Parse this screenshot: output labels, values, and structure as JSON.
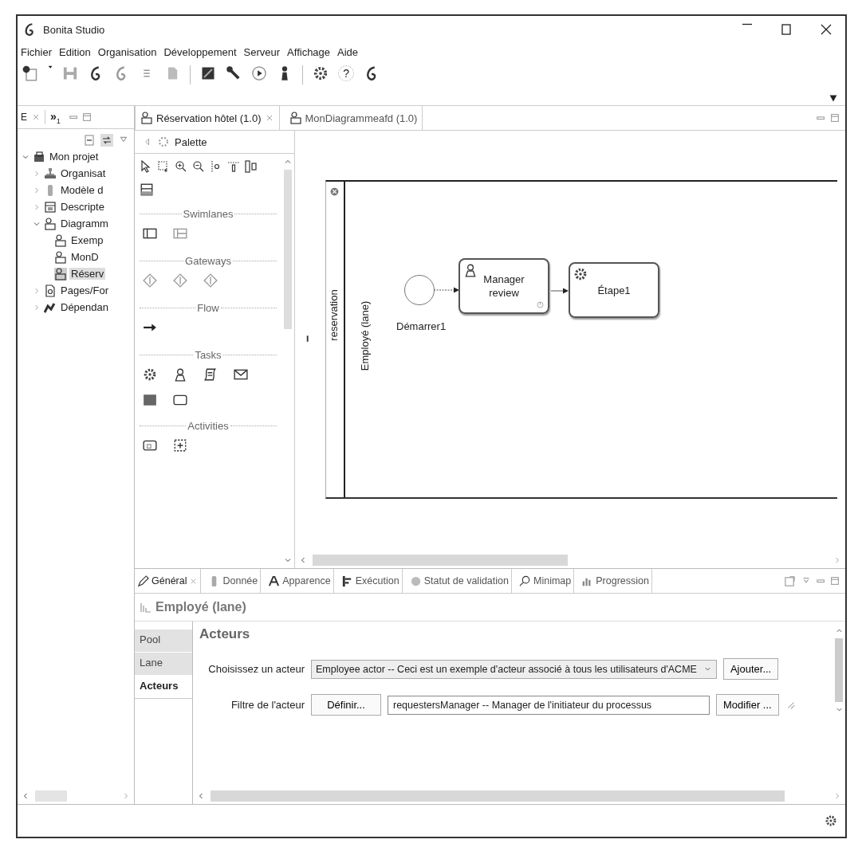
{
  "window": {
    "title": "Bonita Studio"
  },
  "menu": [
    "Fichier",
    "Edition",
    "Organisation",
    "Développement",
    "Serveur",
    "Affichage",
    "Aide"
  ],
  "toolbar": {
    "help_label": "?"
  },
  "explorer": {
    "tab": "E",
    "overflow": {
      "label": "»",
      "count": "1"
    },
    "tree": [
      {
        "label": "Mon projet",
        "expanded": true,
        "selected": false,
        "children": [
          {
            "label": "Organisat",
            "expanded": false,
            "selected": false
          },
          {
            "label": "Modèle d",
            "expanded": false,
            "selected": false
          },
          {
            "label": "Descripte",
            "expanded": false,
            "selected": false
          },
          {
            "label": "Diagramm",
            "expanded": true,
            "selected": false,
            "children": [
              {
                "label": "Exemp",
                "selected": false
              },
              {
                "label": "MonD",
                "selected": false
              },
              {
                "label": "Réserv",
                "selected": true
              }
            ]
          },
          {
            "label": "Pages/For",
            "expanded": false,
            "selected": false
          },
          {
            "label": "Dépendan",
            "expanded": false,
            "selected": false
          }
        ]
      }
    ]
  },
  "editor": {
    "tabs": [
      {
        "label": "Réservation hôtel (1.0)",
        "selected": true
      },
      {
        "label": "MonDiagrammeafd (1.0)",
        "selected": false
      }
    ],
    "palette": {
      "title": "Palette",
      "sections": [
        "Swimlanes",
        "Gateways",
        "Flow",
        "Tasks",
        "Activities"
      ]
    },
    "diagram": {
      "pool": "reservation",
      "lane": "Employé (lane)",
      "start_event": "Démarrer1",
      "tasks": [
        {
          "label": "Manager review",
          "kind": "human"
        },
        {
          "label": "Étape1",
          "kind": "service"
        }
      ]
    }
  },
  "properties": {
    "tabs": [
      {
        "label": "Général",
        "selected": true
      },
      {
        "label": "Donnée",
        "selected": false
      },
      {
        "label": "Apparence",
        "selected": false
      },
      {
        "label": "Exécution",
        "selected": false
      },
      {
        "label": "Statut de validation",
        "selected": false
      },
      {
        "label": "Minimap",
        "selected": false
      },
      {
        "label": "Progression",
        "selected": false
      }
    ],
    "heading": "Employé (lane)",
    "side_tabs": [
      {
        "label": "Pool",
        "selected": false
      },
      {
        "label": "Lane",
        "selected": false
      },
      {
        "label": "Acteurs",
        "selected": true
      }
    ],
    "section": "Acteurs",
    "actor_row": {
      "label": "Choisissez un acteur",
      "value": "Employee actor -- Ceci est un exemple d'acteur associé à tous les utilisateurs d'ACME",
      "button": "Ajouter..."
    },
    "filter_row": {
      "label": "Filtre de l'acteur",
      "define_button": "Définir...",
      "value": "requestersManager -- Manager de l'initiateur du processus",
      "modify_button": "Modifier ..."
    }
  }
}
